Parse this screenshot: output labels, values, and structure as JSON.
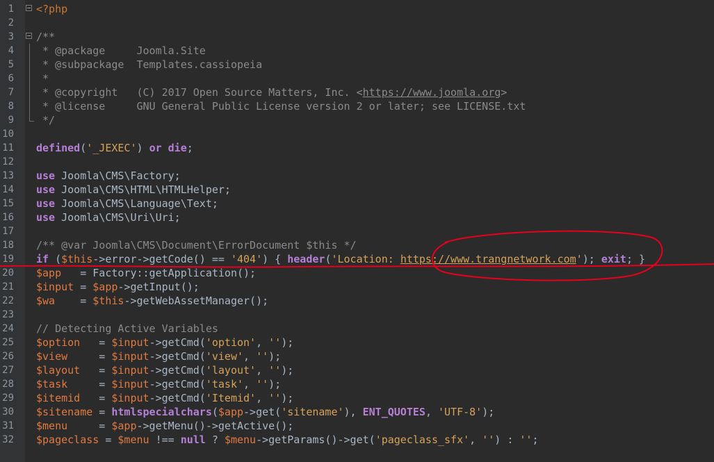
{
  "lines": [
    {
      "n": "1",
      "parts": [
        {
          "t": "<?php",
          "c": "php"
        }
      ],
      "fold": "open"
    },
    {
      "n": "2",
      "parts": []
    },
    {
      "n": "3",
      "parts": [
        {
          "t": "/**",
          "c": "doc"
        }
      ],
      "fold": "open"
    },
    {
      "n": "4",
      "parts": [
        {
          "t": " * @package     Joomla.Site",
          "c": "doc"
        }
      ],
      "fold": "bar"
    },
    {
      "n": "5",
      "parts": [
        {
          "t": " * @subpackage  Templates.cassiopeia",
          "c": "doc"
        }
      ],
      "fold": "bar"
    },
    {
      "n": "6",
      "parts": [
        {
          "t": " *",
          "c": "doc"
        }
      ],
      "fold": "bar"
    },
    {
      "n": "7",
      "parts": [
        {
          "t": " * @copyright   (C) 2017 Open Source Matters, Inc. <",
          "c": "doc"
        },
        {
          "t": "https://www.joomla.org",
          "c": "docurl"
        },
        {
          "t": ">",
          "c": "doc"
        }
      ],
      "fold": "bar"
    },
    {
      "n": "8",
      "parts": [
        {
          "t": " * @license     GNU General Public License version 2 or later; see LICENSE.txt",
          "c": "doc"
        }
      ],
      "fold": "bar"
    },
    {
      "n": "9",
      "parts": [
        {
          "t": " */",
          "c": "doc"
        }
      ],
      "fold": "end"
    },
    {
      "n": "10",
      "parts": []
    },
    {
      "n": "11",
      "parts": [
        {
          "t": "defined",
          "c": "fn"
        },
        {
          "t": "(",
          "c": "plain"
        },
        {
          "t": "'_JEXEC'",
          "c": "str2"
        },
        {
          "t": ") ",
          "c": "plain"
        },
        {
          "t": "or",
          "c": "kw2"
        },
        {
          "t": " ",
          "c": "plain"
        },
        {
          "t": "die",
          "c": "kw2"
        },
        {
          "t": ";",
          "c": "plain"
        }
      ]
    },
    {
      "n": "12",
      "parts": []
    },
    {
      "n": "13",
      "parts": [
        {
          "t": "use",
          "c": "kw2"
        },
        {
          "t": " Joomla\\CMS\\Factory;",
          "c": "plain"
        }
      ]
    },
    {
      "n": "14",
      "parts": [
        {
          "t": "use",
          "c": "kw2"
        },
        {
          "t": " Joomla\\CMS\\HTML\\HTMLHelper;",
          "c": "plain"
        }
      ]
    },
    {
      "n": "15",
      "parts": [
        {
          "t": "use",
          "c": "kw2"
        },
        {
          "t": " Joomla\\CMS\\Language\\Text;",
          "c": "plain"
        }
      ]
    },
    {
      "n": "16",
      "parts": [
        {
          "t": "use",
          "c": "kw2"
        },
        {
          "t": " Joomla\\CMS\\Uri\\Uri;",
          "c": "plain"
        }
      ]
    },
    {
      "n": "17",
      "parts": []
    },
    {
      "n": "18",
      "parts": [
        {
          "t": "/** @var Joomla\\CMS\\Document\\ErrorDocument $this */",
          "c": "doc"
        }
      ]
    },
    {
      "n": "19",
      "parts": [
        {
          "t": "if",
          "c": "kw2"
        },
        {
          "t": " (",
          "c": "plain"
        },
        {
          "t": "$this",
          "c": "var"
        },
        {
          "t": "->error->getCode() == ",
          "c": "plain"
        },
        {
          "t": "'404'",
          "c": "str2"
        },
        {
          "t": ") { ",
          "c": "plain"
        },
        {
          "t": "header",
          "c": "fn"
        },
        {
          "t": "(",
          "c": "plain"
        },
        {
          "t": "'Location: ",
          "c": "str2"
        },
        {
          "t": "https://www.trangnetwork.com",
          "c": "url2"
        },
        {
          "t": "'",
          "c": "str2"
        },
        {
          "t": "); ",
          "c": "plain"
        },
        {
          "t": "exit",
          "c": "kw2"
        },
        {
          "t": "; }",
          "c": "plain"
        }
      ]
    },
    {
      "n": "20",
      "parts": [
        {
          "t": "$app",
          "c": "var"
        },
        {
          "t": "   = Factory::getApplication();",
          "c": "plain"
        }
      ]
    },
    {
      "n": "21",
      "parts": [
        {
          "t": "$input",
          "c": "var"
        },
        {
          "t": " = ",
          "c": "plain"
        },
        {
          "t": "$app",
          "c": "var"
        },
        {
          "t": "->getInput();",
          "c": "plain"
        }
      ]
    },
    {
      "n": "22",
      "parts": [
        {
          "t": "$wa",
          "c": "var"
        },
        {
          "t": "    = ",
          "c": "plain"
        },
        {
          "t": "$this",
          "c": "var"
        },
        {
          "t": "->getWebAssetManager();",
          "c": "plain"
        }
      ]
    },
    {
      "n": "23",
      "parts": []
    },
    {
      "n": "24",
      "parts": [
        {
          "t": "// Detecting Active Variables",
          "c": "doc"
        }
      ]
    },
    {
      "n": "25",
      "parts": [
        {
          "t": "$option",
          "c": "var"
        },
        {
          "t": "   = ",
          "c": "plain"
        },
        {
          "t": "$input",
          "c": "var"
        },
        {
          "t": "->getCmd(",
          "c": "plain"
        },
        {
          "t": "'option'",
          "c": "str2"
        },
        {
          "t": ", ",
          "c": "plain"
        },
        {
          "t": "''",
          "c": "str2"
        },
        {
          "t": ");",
          "c": "plain"
        }
      ]
    },
    {
      "n": "26",
      "parts": [
        {
          "t": "$view",
          "c": "var"
        },
        {
          "t": "     = ",
          "c": "plain"
        },
        {
          "t": "$input",
          "c": "var"
        },
        {
          "t": "->getCmd(",
          "c": "plain"
        },
        {
          "t": "'view'",
          "c": "str2"
        },
        {
          "t": ", ",
          "c": "plain"
        },
        {
          "t": "''",
          "c": "str2"
        },
        {
          "t": ");",
          "c": "plain"
        }
      ]
    },
    {
      "n": "27",
      "parts": [
        {
          "t": "$layout",
          "c": "var"
        },
        {
          "t": "   = ",
          "c": "plain"
        },
        {
          "t": "$input",
          "c": "var"
        },
        {
          "t": "->getCmd(",
          "c": "plain"
        },
        {
          "t": "'layout'",
          "c": "str2"
        },
        {
          "t": ", ",
          "c": "plain"
        },
        {
          "t": "''",
          "c": "str2"
        },
        {
          "t": ");",
          "c": "plain"
        }
      ]
    },
    {
      "n": "28",
      "parts": [
        {
          "t": "$task",
          "c": "var"
        },
        {
          "t": "     = ",
          "c": "plain"
        },
        {
          "t": "$input",
          "c": "var"
        },
        {
          "t": "->getCmd(",
          "c": "plain"
        },
        {
          "t": "'task'",
          "c": "str2"
        },
        {
          "t": ", ",
          "c": "plain"
        },
        {
          "t": "''",
          "c": "str2"
        },
        {
          "t": ");",
          "c": "plain"
        }
      ]
    },
    {
      "n": "29",
      "parts": [
        {
          "t": "$itemid",
          "c": "var"
        },
        {
          "t": "   = ",
          "c": "plain"
        },
        {
          "t": "$input",
          "c": "var"
        },
        {
          "t": "->getCmd(",
          "c": "plain"
        },
        {
          "t": "'Itemid'",
          "c": "str2"
        },
        {
          "t": ", ",
          "c": "plain"
        },
        {
          "t": "''",
          "c": "str2"
        },
        {
          "t": ");",
          "c": "plain"
        }
      ]
    },
    {
      "n": "30",
      "parts": [
        {
          "t": "$sitename",
          "c": "var"
        },
        {
          "t": " = ",
          "c": "plain"
        },
        {
          "t": "htmlspecialchars",
          "c": "fn"
        },
        {
          "t": "(",
          "c": "plain"
        },
        {
          "t": "$app",
          "c": "var"
        },
        {
          "t": "->get(",
          "c": "plain"
        },
        {
          "t": "'sitename'",
          "c": "str2"
        },
        {
          "t": "), ",
          "c": "plain"
        },
        {
          "t": "ENT_QUOTES",
          "c": "const"
        },
        {
          "t": ", ",
          "c": "plain"
        },
        {
          "t": "'UTF-8'",
          "c": "str2"
        },
        {
          "t": ");",
          "c": "plain"
        }
      ]
    },
    {
      "n": "31",
      "parts": [
        {
          "t": "$menu",
          "c": "var"
        },
        {
          "t": "     = ",
          "c": "plain"
        },
        {
          "t": "$app",
          "c": "var"
        },
        {
          "t": "->getMenu()->getActive();",
          "c": "plain"
        }
      ]
    },
    {
      "n": "32",
      "parts": [
        {
          "t": "$pageclass",
          "c": "var"
        },
        {
          "t": " = ",
          "c": "plain"
        },
        {
          "t": "$menu",
          "c": "var"
        },
        {
          "t": " !== ",
          "c": "plain"
        },
        {
          "t": "null",
          "c": "null"
        },
        {
          "t": " ? ",
          "c": "plain"
        },
        {
          "t": "$menu",
          "c": "var"
        },
        {
          "t": "->getParams()->get(",
          "c": "plain"
        },
        {
          "t": "'pageclass_sfx'",
          "c": "str2"
        },
        {
          "t": ", ",
          "c": "plain"
        },
        {
          "t": "''",
          "c": "str2"
        },
        {
          "t": ") : ",
          "c": "plain"
        },
        {
          "t": "''",
          "c": "str2"
        },
        {
          "t": ";",
          "c": "plain"
        }
      ]
    }
  ],
  "colors": {
    "background": "#2b2b2b",
    "gutter": "#313335",
    "annotation": "#e8001c"
  }
}
